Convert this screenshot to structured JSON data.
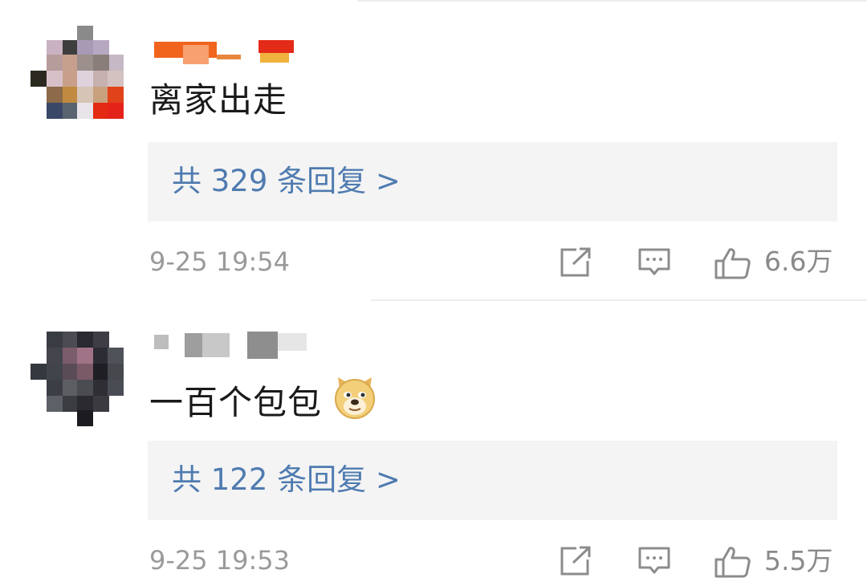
{
  "comments": [
    {
      "text": "离家出走",
      "reply_link": "共 329 条回复 >",
      "timestamp": "9-25 19:54",
      "likes": "6.6万"
    },
    {
      "text": "一百个包包",
      "emoji": "doge-emoji",
      "reply_link": "共 122 条回复 >",
      "timestamp": "9-25 19:53",
      "likes": "5.5万"
    }
  ],
  "icons": {
    "share": "share-icon",
    "comment": "comment-icon",
    "like": "thumbs-up-icon"
  },
  "colors": {
    "reply_link": "#4f7bb0",
    "reply_box_bg": "#f4f4f4",
    "meta_text": "#9a9a9a",
    "icon_stroke": "#8c8c8c"
  }
}
